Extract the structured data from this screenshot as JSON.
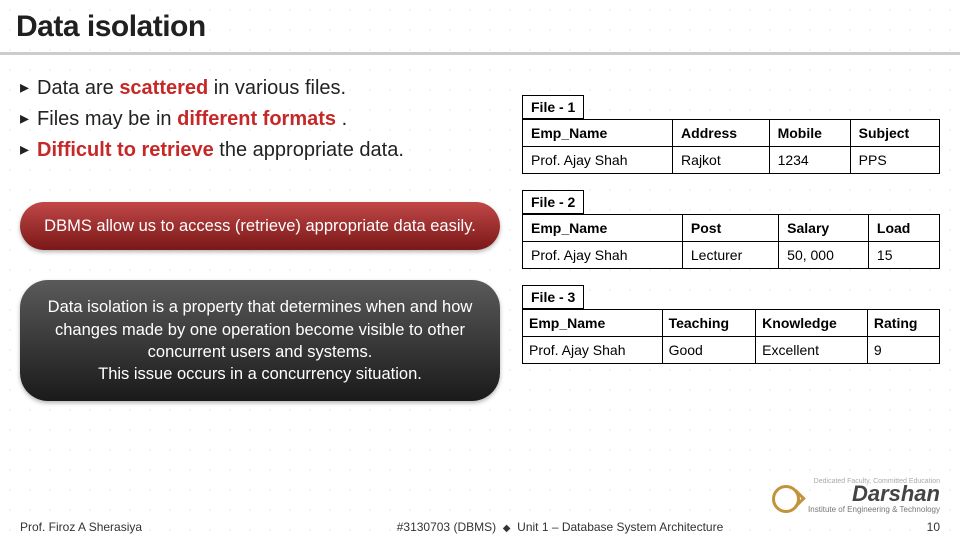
{
  "title": "Data isolation",
  "bullets": [
    {
      "pre": "Data are ",
      "emph": "scattered",
      "post": " in various files."
    },
    {
      "pre": "Files may be in ",
      "emph": "different formats",
      "post": " ."
    },
    {
      "pre": "",
      "emph": "Difficult to retrieve",
      "post": " the appropriate data."
    }
  ],
  "callout1": "DBMS allow us to access (retrieve) appropriate data easily.",
  "callout2": "Data isolation is a property that determines when and how changes made by one operation become visible to other concurrent users and systems.\nThis issue occurs in a concurrency situation.",
  "files": [
    {
      "label": "File - 1",
      "headers": [
        "Emp_Name",
        "Address",
        "Mobile",
        "Subject"
      ],
      "rows": [
        [
          "Prof. Ajay Shah",
          "Rajkot",
          "1234",
          "PPS"
        ]
      ]
    },
    {
      "label": "File - 2",
      "headers": [
        "Emp_Name",
        "Post",
        "Salary",
        "Load"
      ],
      "rows": [
        [
          "Prof. Ajay Shah",
          "Lecturer",
          "50, 000",
          "15"
        ]
      ]
    },
    {
      "label": "File - 3",
      "headers": [
        "Emp_Name",
        "Teaching",
        "Knowledge",
        "Rating"
      ],
      "rows": [
        [
          "Prof. Ajay Shah",
          "Good",
          "Excellent",
          "9"
        ]
      ]
    }
  ],
  "footer": {
    "author": "Prof. Firoz A Sherasiya",
    "course_code": "#3130703 (DBMS)",
    "unit": "Unit 1 – Database System Architecture",
    "page": "10"
  },
  "logo": {
    "motto": "Dedicated Faculty, Committed Education",
    "name": "Darshan",
    "sub": "Institute of Engineering & Technology"
  }
}
